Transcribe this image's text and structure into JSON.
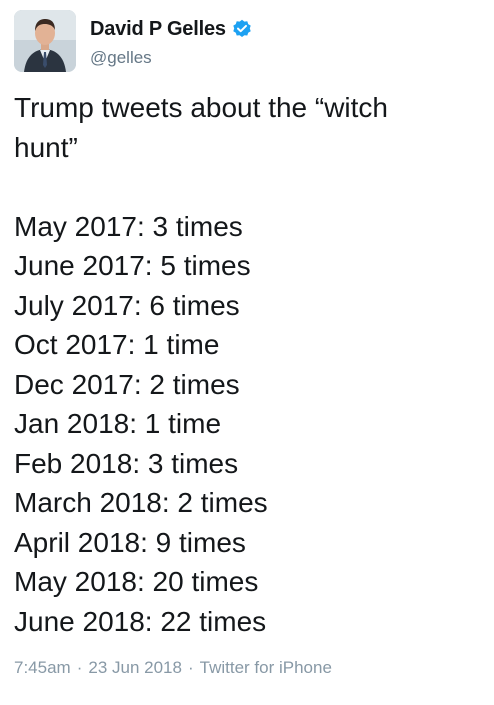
{
  "author": {
    "display_name": "David P Gelles",
    "handle": "@gelles",
    "verified": true,
    "verified_color": "#1da1f2"
  },
  "tweet": {
    "intro_lines": [
      "Trump tweets about the “witch",
      "hunt”"
    ],
    "list": [
      "May 2017: 3 times",
      "June 2017: 5 times",
      "July 2017: 6 times",
      "Oct 2017: 1 time",
      "Dec 2017: 2 times",
      "Jan 2018: 1 time",
      "Feb 2018: 3 times",
      "March 2018: 2 times",
      "April 2018: 9 times",
      "May 2018: 20 times",
      "June 2018: 22 times"
    ]
  },
  "meta": {
    "time": "7:45am",
    "date": "23 Jun 2018",
    "source": "Twitter for iPhone",
    "separator": "·"
  },
  "icons": {
    "avatar": "profile-photo",
    "verified": "verified-badge-icon"
  }
}
